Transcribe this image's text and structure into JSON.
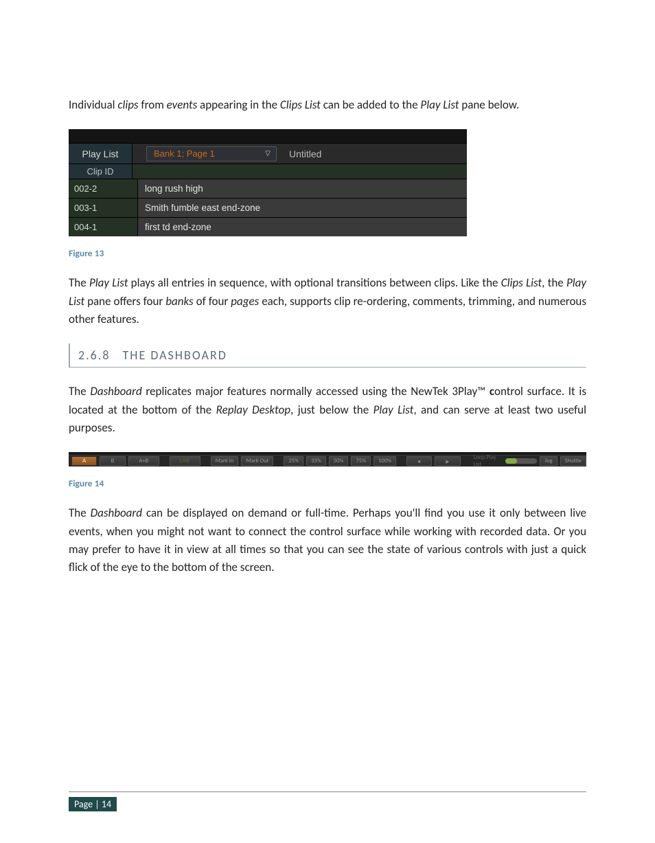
{
  "para1_a": "Individual ",
  "para1_b": "clips",
  "para1_c": " from ",
  "para1_d": "events",
  "para1_e": " appearing in the ",
  "para1_f": "Clips List",
  "para1_g": " can be added to the ",
  "para1_h": "Play List",
  "para1_i": " pane below.",
  "playlist": {
    "header_side": "Play List",
    "bank_label": "Bank 1; Page 1",
    "title": "Untitled",
    "col_side": "Clip ID",
    "rows": [
      {
        "id": "002-2",
        "desc": "long rush high"
      },
      {
        "id": "003-1",
        "desc": "Smith fumble east end-zone"
      },
      {
        "id": "004-1",
        "desc": "first td end-zone"
      }
    ]
  },
  "caption1": "Figure 13",
  "para2_a": "The ",
  "para2_b": "Play List",
  "para2_c": " plays all entries in sequence, with optional transitions between clips.  Like the ",
  "para2_d": "Clips List",
  "para2_e": ", the ",
  "para2_f": "Play List",
  "para2_g": " pane offers four ",
  "para2_h": "banks",
  "para2_i": " of four ",
  "para2_j": "pages",
  "para2_k": " each, supports clip re-ordering, comments, trimming, and numerous other features.",
  "section": {
    "num": "2.6.8",
    "title": "THE DASHBOARD"
  },
  "para3_a": "The ",
  "para3_b": "Dashboard",
  "para3_c": " replicates major features normally accessed using the NewTek 3Play™ ",
  "para3_d": "c",
  "para3_e": "ontrol surface.  It is located at the bottom of the ",
  "para3_f": "Replay Desktop",
  "para3_g": ", just below the ",
  "para3_h": "Play List",
  "para3_i": ", and can serve at least two useful purposes.",
  "dashboard": {
    "btn_a": "A",
    "btn_b": "B",
    "btn_ab": "A+B",
    "btn_live": "LIVE",
    "btn_markin": "Mark In",
    "btn_markout": "Mark Out",
    "btn_25": "25%",
    "btn_33": "33%",
    "btn_50": "50%",
    "btn_75": "75%",
    "btn_100": "100%",
    "loop_label": "Loop Play List",
    "jog": "Jog",
    "shuttle": "Shuttle"
  },
  "caption2": "Figure 14",
  "para4_a": "The ",
  "para4_b": "Dashboard",
  "para4_c": " can be displayed on demand or full-time.  Perhaps you'll find you use it only between live events, when you might not want to connect the control surface while working with recorded data.  Or you may prefer to have it in view at all times so that you can see the state of various controls with just a quick flick of the eye to the bottom of the screen.",
  "footer": {
    "label": "Page | 14"
  }
}
